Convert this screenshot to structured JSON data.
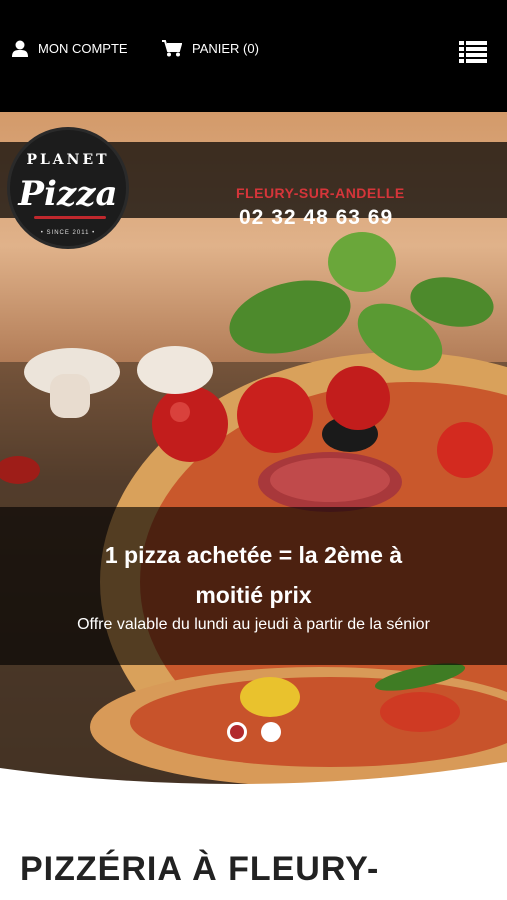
{
  "header": {
    "account_label": "MON COMPTE",
    "cart_label": "PANIER (0)",
    "menu_icon": "hamburger-menu-icon"
  },
  "brand": {
    "logo_top": "PLANET",
    "logo_main": "Pizza",
    "logo_since": "• SINCE 2011 •"
  },
  "location": {
    "city": "FLEURY-SUR-ANDELLE",
    "phone": "02 32 48 63 69"
  },
  "hero": {
    "promo_title_line1": "1 pizza achetée = la 2ème à",
    "promo_title_line2": "moitié prix",
    "promo_subtitle": "Offre valable du lundi au jeudi à partir de la sénior",
    "slide_count": 2,
    "active_slide": 1
  },
  "section": {
    "title": "PIZZÉRIA À FLEURY-"
  },
  "colors": {
    "accent_red": "#d6353a",
    "dot_active": "#b22a2e",
    "topbar": "#000000"
  }
}
